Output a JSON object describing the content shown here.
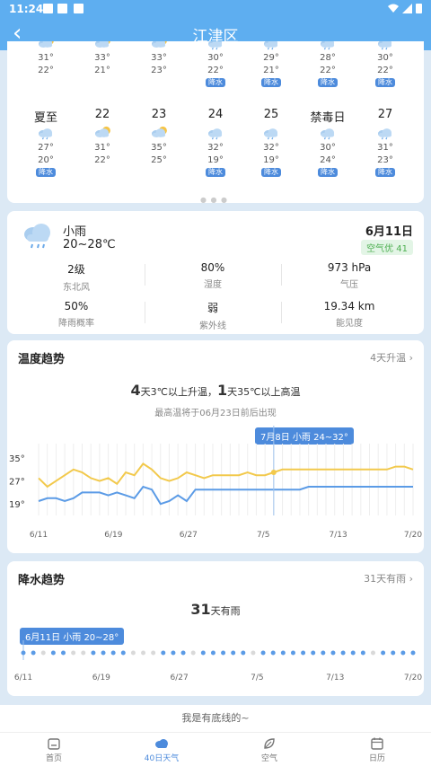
{
  "status_bar": {
    "time": "11:24",
    "icons": [
      "image-icon",
      "notification-icon",
      "a-icon"
    ],
    "right_icons": [
      "wifi-icon",
      "signal-icon",
      "battery-icon"
    ]
  },
  "header": {
    "title": "江津区",
    "back_icon": "chevron-left-icon"
  },
  "calendar": {
    "row1": [
      {
        "label": "",
        "high": "31°",
        "low": "22°",
        "rain": false,
        "icon": "sun-cloud-icon"
      },
      {
        "label": "",
        "high": "33°",
        "low": "21°",
        "rain": false,
        "icon": "sun-cloud-icon"
      },
      {
        "label": "",
        "high": "33°",
        "low": "23°",
        "rain": false,
        "icon": "sun-cloud-icon"
      },
      {
        "label": "",
        "high": "30°",
        "low": "22°",
        "rain": true,
        "icon": "rain-cloud-icon"
      },
      {
        "label": "",
        "high": "29°",
        "low": "21°",
        "rain": true,
        "icon": "rain-cloud-icon"
      },
      {
        "label": "",
        "high": "28°",
        "low": "22°",
        "rain": true,
        "icon": "rain-cloud-icon"
      },
      {
        "label": "",
        "high": "30°",
        "low": "22°",
        "rain": true,
        "icon": "rain-cloud-icon"
      }
    ],
    "row2": [
      {
        "label": "夏至",
        "high": "27°",
        "low": "20°",
        "rain": true,
        "icon": "rain-cloud-icon"
      },
      {
        "label": "22",
        "high": "31°",
        "low": "22°",
        "rain": false,
        "icon": "sun-cloud-icon"
      },
      {
        "label": "23",
        "high": "35°",
        "low": "25°",
        "rain": false,
        "icon": "sun-cloud-icon"
      },
      {
        "label": "24",
        "high": "32°",
        "low": "19°",
        "rain": true,
        "icon": "rain-cloud-icon"
      },
      {
        "label": "25",
        "high": "32°",
        "low": "19°",
        "rain": true,
        "icon": "rain-cloud-icon"
      },
      {
        "label": "禁毒日",
        "high": "30°",
        "low": "24°",
        "rain": true,
        "icon": "rain-cloud-icon"
      },
      {
        "label": "27",
        "high": "31°",
        "low": "23°",
        "rain": true,
        "icon": "rain-cloud-icon"
      }
    ],
    "rain_tag": "降水"
  },
  "today": {
    "weather": "小雨",
    "range": "20~28℃",
    "date": "6月11日",
    "aqi": "空气优 41",
    "stats": [
      {
        "value": "2级",
        "label": "东北风"
      },
      {
        "value": "80%",
        "label": "湿度"
      },
      {
        "value": "973 hPa",
        "label": "气压"
      },
      {
        "value": "50%",
        "label": "降雨概率"
      },
      {
        "value": "弱",
        "label": "紫外线"
      },
      {
        "value": "19.34 km",
        "label": "能见度"
      }
    ]
  },
  "temp_trend": {
    "title": "温度趋势",
    "more": "4天升温",
    "headline_num1": "4",
    "headline_txt1": "天3℃以上升温，",
    "headline_num2": "1",
    "headline_txt2": "天35℃以上高温",
    "subline": "最高温将于06月23日前后出现",
    "tooltip": "7月8日 小雨 24~32°"
  },
  "rain_trend": {
    "title": "降水趋势",
    "more": "31天有雨",
    "headline_num": "31",
    "headline_txt": "天有雨",
    "tooltip": "6月11日 小雨 20~28°"
  },
  "chart_data": [
    {
      "type": "line",
      "title": "温度趋势",
      "y_ticks": [
        "35°",
        "27°",
        "19°"
      ],
      "ylim": [
        15,
        40
      ],
      "x_tick_labels": [
        "6/11",
        "6/19",
        "6/27",
        "7/5",
        "7/13",
        "7/20"
      ],
      "series": [
        {
          "name": "",
          "color": "#f2c94c",
          "values": [
            28,
            25,
            27,
            29,
            31,
            30,
            28,
            27,
            28,
            26,
            30,
            29,
            33,
            31,
            28,
            27,
            28,
            30,
            29,
            28,
            29,
            29,
            29,
            29,
            30,
            29,
            29,
            30,
            31,
            31,
            31,
            31,
            31,
            31,
            31,
            31,
            31,
            31,
            31,
            31,
            31,
            32,
            32,
            31
          ]
        },
        {
          "name": "",
          "color": "#5b9be6",
          "values": [
            20,
            21,
            21,
            20,
            21,
            23,
            23,
            23,
            22,
            23,
            22,
            21,
            25,
            24,
            19,
            20,
            22,
            20,
            24,
            24,
            24,
            24,
            24,
            24,
            24,
            24,
            24,
            24,
            24,
            24,
            24,
            25,
            25,
            25,
            25,
            25,
            25,
            25,
            25,
            25,
            25,
            25,
            25,
            25
          ]
        }
      ],
      "highlight_index": 27
    },
    {
      "type": "scatter",
      "title": "降水趋势",
      "x_tick_labels": [
        "6/11",
        "6/19",
        "6/27",
        "7/5",
        "7/13",
        "7/20"
      ],
      "rain_days": [
        1,
        1,
        0,
        1,
        1,
        0,
        0,
        1,
        1,
        1,
        1,
        0,
        0,
        0,
        1,
        1,
        1,
        0,
        1,
        1,
        1,
        1,
        1,
        0,
        1,
        1,
        1,
        1,
        1,
        1,
        1,
        1,
        1,
        1,
        1,
        0,
        1,
        1,
        1,
        1
      ]
    }
  ],
  "footer": {
    "text": "我是有底线的~"
  },
  "nav": [
    {
      "label": "首页",
      "icon": "home-icon",
      "active": false
    },
    {
      "label": "40日天气",
      "icon": "cloud-icon",
      "active": true
    },
    {
      "label": "空气",
      "icon": "leaf-icon",
      "active": false
    },
    {
      "label": "日历",
      "icon": "calendar-icon",
      "active": false
    }
  ],
  "colors": {
    "header": "#5eaef0",
    "accent": "#4d8bdc",
    "high": "#f2c94c",
    "low": "#5b9be6"
  }
}
